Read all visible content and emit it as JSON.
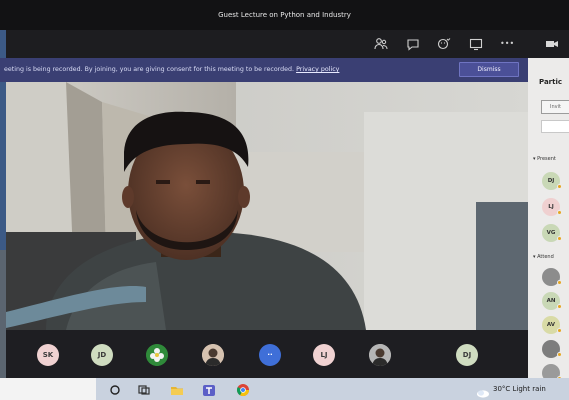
{
  "window": {
    "title": "Guest Lecture on Python and Industry"
  },
  "toolbar": {
    "icons": [
      "participants-icon",
      "chat-icon",
      "reactions-icon",
      "share-tray-icon",
      "more-options-icon",
      "camera-icon"
    ],
    "more_label": "•••"
  },
  "banner": {
    "message": "eeting is being recorded. By joining, you are giving consent for this meeting to be recorded.",
    "link": "Privacy policy",
    "dismiss_label": "Dismiss"
  },
  "panel": {
    "title": "Partic",
    "invite_placeholder": "Invit",
    "presenters_label": "▾ Present",
    "attendees_label": "▾ Attend",
    "presenters": [
      {
        "initials": "DJ",
        "color": "#c9d8b6"
      },
      {
        "initials": "LJ",
        "color": "#efd0d0"
      },
      {
        "initials": "VG",
        "color": "#c9d8b6"
      }
    ],
    "attendees": [
      {
        "initials": "",
        "color": "#8c8c8c",
        "kind": "photo"
      },
      {
        "initials": "AN",
        "color": "#c9d8b6"
      },
      {
        "initials": "AV",
        "color": "#d9dba6"
      },
      {
        "initials": "",
        "color": "#7d7d7d",
        "kind": "photo"
      },
      {
        "initials": "",
        "color": "#9a9a9a",
        "kind": "photo"
      }
    ]
  },
  "gallery": {
    "tiles": [
      {
        "initials": "SK",
        "color": "#f0d2d2",
        "kind": "initials"
      },
      {
        "initials": "JD",
        "color": "#cfdcc0",
        "kind": "initials"
      },
      {
        "initials": "",
        "color": "#2f8a3a",
        "kind": "flower"
      },
      {
        "initials": "",
        "color": "#d6c2b0",
        "kind": "photo"
      },
      {
        "initials": "··",
        "color": "#3f6fd8",
        "kind": "initials"
      },
      {
        "initials": "LJ",
        "color": "#f0d2d2",
        "kind": "initials"
      },
      {
        "initials": "",
        "color": "#b6b6b6",
        "kind": "photo"
      },
      {
        "initials": "DJ",
        "color": "#cfdcc0",
        "kind": "initials"
      }
    ]
  },
  "taskbar": {
    "weather": "30°C  Light rain"
  }
}
